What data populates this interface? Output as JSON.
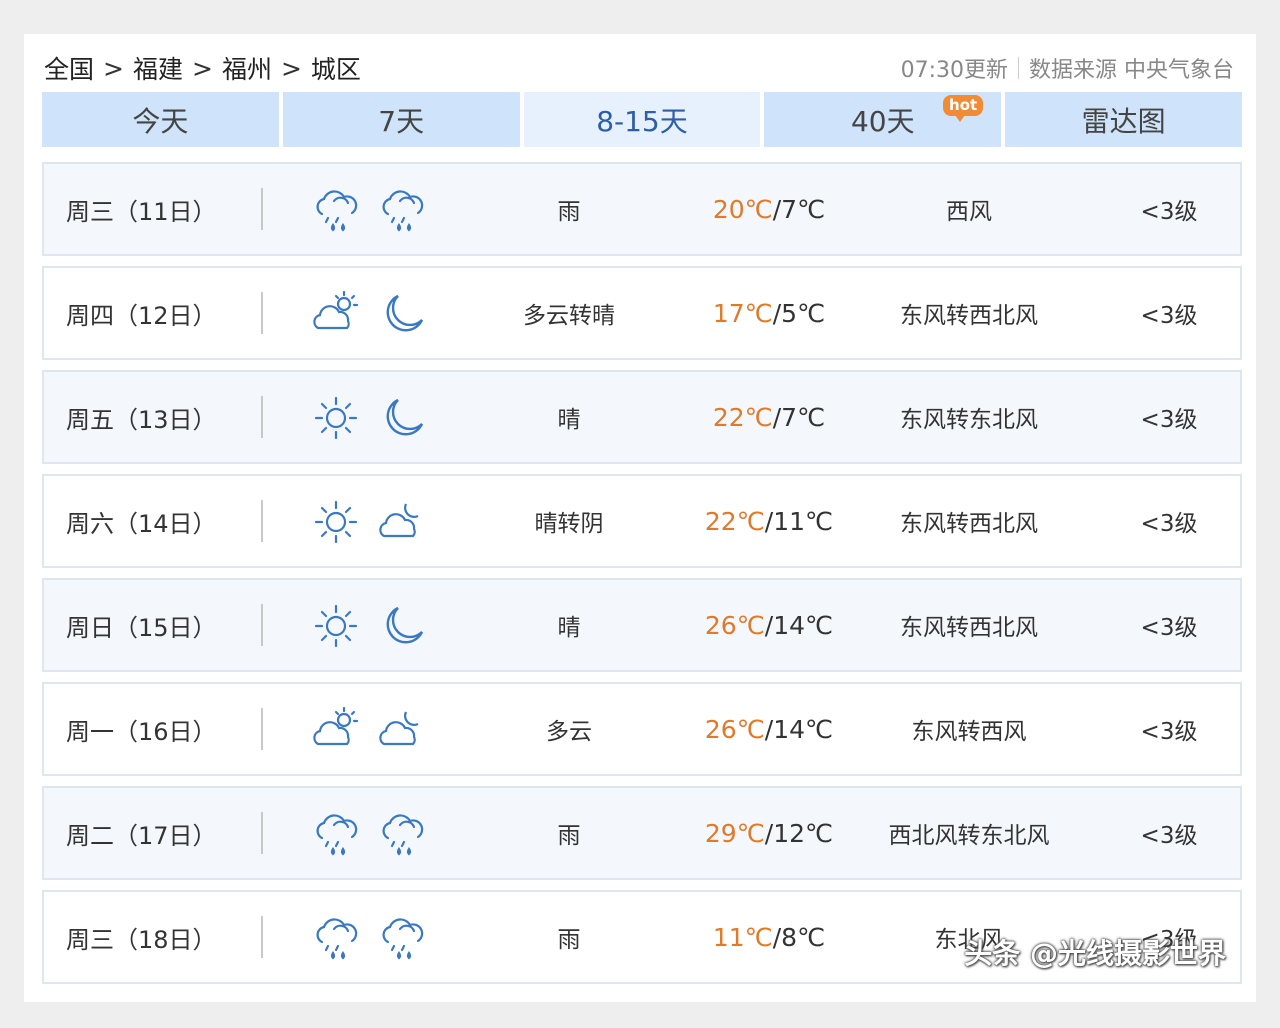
{
  "breadcrumb": {
    "items": [
      "全国",
      "福建",
      "福州",
      "城区"
    ],
    "separator": ">"
  },
  "header": {
    "update_time": "07:30更新",
    "source": "数据来源 中央气象台"
  },
  "tabs": [
    {
      "label": "今天",
      "active": false
    },
    {
      "label": "7天",
      "active": false
    },
    {
      "label": "8-15天",
      "active": true
    },
    {
      "label": "40天",
      "active": false,
      "badge": "hot"
    },
    {
      "label": "雷达图",
      "active": false
    }
  ],
  "forecast": [
    {
      "day": "周三（11日）",
      "icon_day": "rain-icon",
      "icon_night": "rain-icon",
      "desc": "雨",
      "high": "20℃",
      "low": "7℃",
      "wind": "西风",
      "level": "<3级"
    },
    {
      "day": "周四（12日）",
      "icon_day": "partly-cloudy-day-icon",
      "icon_night": "moon-icon",
      "desc": "多云转晴",
      "high": "17℃",
      "low": "5℃",
      "wind": "东风转西北风",
      "level": "<3级"
    },
    {
      "day": "周五（13日）",
      "icon_day": "sun-icon",
      "icon_night": "moon-icon",
      "desc": "晴",
      "high": "22℃",
      "low": "7℃",
      "wind": "东风转东北风",
      "level": "<3级"
    },
    {
      "day": "周六（14日）",
      "icon_day": "sun-icon",
      "icon_night": "cloudy-night-icon",
      "desc": "晴转阴",
      "high": "22℃",
      "low": "11℃",
      "wind": "东风转西北风",
      "level": "<3级"
    },
    {
      "day": "周日（15日）",
      "icon_day": "sun-icon",
      "icon_night": "moon-icon",
      "desc": "晴",
      "high": "26℃",
      "low": "14℃",
      "wind": "东风转西北风",
      "level": "<3级"
    },
    {
      "day": "周一（16日）",
      "icon_day": "partly-cloudy-day-icon",
      "icon_night": "cloudy-night-icon",
      "desc": "多云",
      "high": "26℃",
      "low": "14℃",
      "wind": "东风转西风",
      "level": "<3级"
    },
    {
      "day": "周二（17日）",
      "icon_day": "rain-icon",
      "icon_night": "rain-icon",
      "desc": "雨",
      "high": "29℃",
      "low": "12℃",
      "wind": "西北风转东北风",
      "level": "<3级"
    },
    {
      "day": "周三（18日）",
      "icon_day": "rain-icon",
      "icon_night": "rain-icon",
      "desc": "雨",
      "high": "11℃",
      "low": "8℃",
      "wind": "东北风",
      "level": "<3级"
    }
  ],
  "watermark": "头条 @光线摄影世界",
  "colors": {
    "tab_bg": "#cfe4fa",
    "tab_active_bg": "#e6f1fd",
    "tab_active_text": "#2c5fa8",
    "high_temp": "#e07a2b",
    "icon_stroke": "#3a78c2",
    "hot_badge": "#f08c35"
  }
}
